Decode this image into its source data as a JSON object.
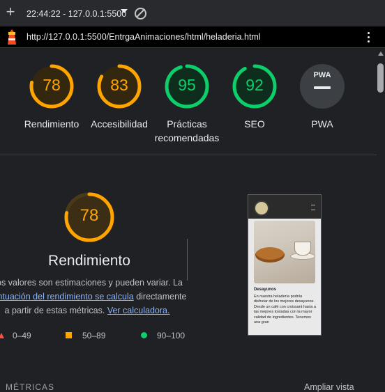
{
  "toolbar": {
    "report_label": "22:44:22 - 127.0.0.1:5500",
    "new_report_icon": "plus-icon",
    "clear_icon": "block-icon"
  },
  "urlbar": {
    "url": "http://127.0.0.1:5500/EntrgaAnimaciones/html/heladeria.html"
  },
  "gauges": [
    {
      "label": "Rendimiento",
      "value": "78",
      "color": "#ffa400",
      "score": 0.78
    },
    {
      "label": "Accesibilidad",
      "value": "83",
      "color": "#ffa400",
      "score": 0.83
    },
    {
      "label": "Prácticas\nrecomendadas",
      "value": "95",
      "color": "#0cce6b",
      "score": 0.95
    },
    {
      "label": "SEO",
      "value": "92",
      "color": "#0cce6b",
      "score": 0.92
    },
    {
      "label": "PWA",
      "value": "PWA",
      "color": "#9aa0a6"
    }
  ],
  "performance": {
    "score": "78",
    "score_fraction": 0.78,
    "title": "Rendimiento",
    "desc_part1": "Los valores son estimaciones y pueden variar. La ",
    "desc_link": "puntuación del rendimiento se calcula",
    "desc_part2": " directamente a partir de estas métricas. ",
    "desc_link2": "Ver calculadora."
  },
  "legend": {
    "fail": "0–49",
    "average": "50–89",
    "pass": "90–100"
  },
  "thumbnail": {
    "heading": "Desayunos",
    "text": "En nuestra heladería podrás disfrutar de los mejores desayunos. Desde un café con croissant hasta a las mejores tostadas con la mayor calidad de ingredientes. Tenemos una gran"
  },
  "footer": {
    "metrics_label": "MÉTRICAS",
    "expand_label": "Ampliar vista"
  },
  "colors": {
    "fail": "#ff4e42",
    "average": "#ffa400",
    "pass": "#0cce6b",
    "link": "#8ab4f8"
  }
}
